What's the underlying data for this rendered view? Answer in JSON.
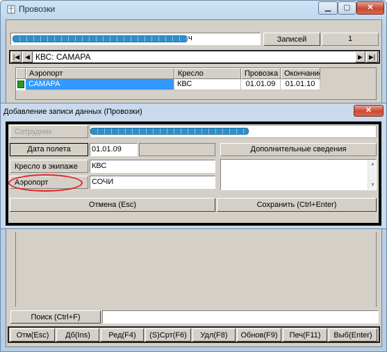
{
  "window": {
    "title": "Провозки",
    "minimize_glyph": "▁",
    "maximize_glyph": "▢",
    "close_glyph": "✕"
  },
  "top_bar": {
    "field_suffix": "ч",
    "records_label": "Записей",
    "records_count": "1"
  },
  "filter": {
    "first_glyph": "|◀",
    "prev_glyph": "◀",
    "text": "КВС: САМАРА",
    "next_glyph": "▶",
    "last_glyph": "▶|"
  },
  "grid": {
    "columns": [
      "Аэропорт",
      "Кресло",
      "Провозка",
      "Окончание"
    ],
    "rows": [
      {
        "airport": "САМАРА",
        "seat": "КВС",
        "date": "01.01.09",
        "end": "01.01.10"
      }
    ]
  },
  "dialog": {
    "title": "Добавление записи данных (Провозки)",
    "close_glyph": "✕",
    "employee_label": "Сотрудник",
    "flight_date_label": "Дата полета",
    "flight_date_value": "01.01.09",
    "extra_label": "Дополнительные сведения",
    "seat_label": "Кресло в экипаже",
    "seat_value": "КВС",
    "airport_label": "Аэропорт",
    "airport_value": "СОЧИ",
    "cancel_label": "Отмена (Esc)",
    "save_label": "Сохранить (Ctrl+Enter)"
  },
  "search": {
    "label": "Поиск (Ctrl+F)"
  },
  "toolbar": [
    "Отм(Esc)",
    "Дб(Ins)",
    "Ред(F4)",
    "(S)Срт(F6)",
    "Удл(F8)",
    "Обнов(F9)",
    "Печ(F11)",
    "Выб(Enter)"
  ],
  "colors": {
    "selection": "#3399ff",
    "annotation": "#e02020"
  }
}
